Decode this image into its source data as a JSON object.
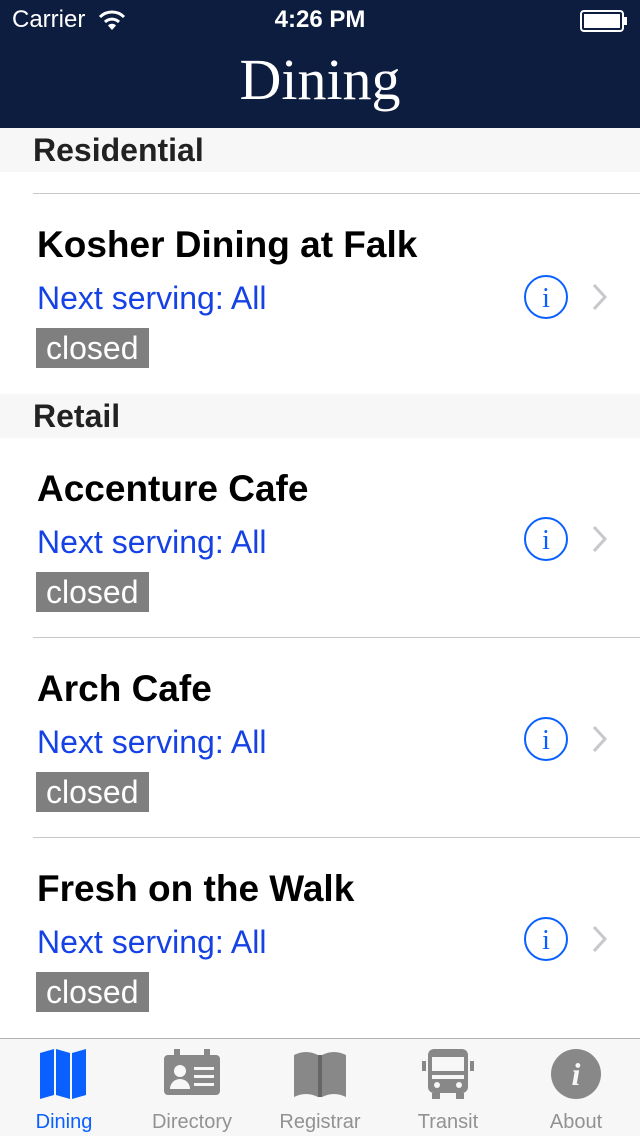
{
  "status_bar": {
    "carrier": "Carrier",
    "time": "4:26 PM"
  },
  "nav": {
    "title": "Dining"
  },
  "sections": [
    {
      "title": "Residential"
    },
    {
      "title": "Retail"
    }
  ],
  "rows": [
    {
      "name": "Kosher Dining at Falk",
      "next": "Next serving: All",
      "status": "closed"
    },
    {
      "name": "Accenture Cafe",
      "next": "Next serving: All",
      "status": "closed"
    },
    {
      "name": "Arch Cafe",
      "next": "Next serving: All",
      "status": "closed"
    },
    {
      "name": "Fresh on the Walk",
      "next": "Next serving: All",
      "status": "closed"
    }
  ],
  "tabs": [
    {
      "label": "Dining",
      "icon": "map-icon",
      "active": true
    },
    {
      "label": "Directory",
      "icon": "id-card-icon",
      "active": false
    },
    {
      "label": "Registrar",
      "icon": "book-icon",
      "active": false
    },
    {
      "label": "Transit",
      "icon": "bus-icon",
      "active": false
    },
    {
      "label": "About",
      "icon": "info-circle-icon",
      "active": false
    }
  ],
  "colors": {
    "nav_bg": "#0c1d3f",
    "link_blue": "#1542e6",
    "badge_gray": "#7f7f7f",
    "tab_active": "#0a60ff",
    "tab_inactive": "#929292"
  }
}
